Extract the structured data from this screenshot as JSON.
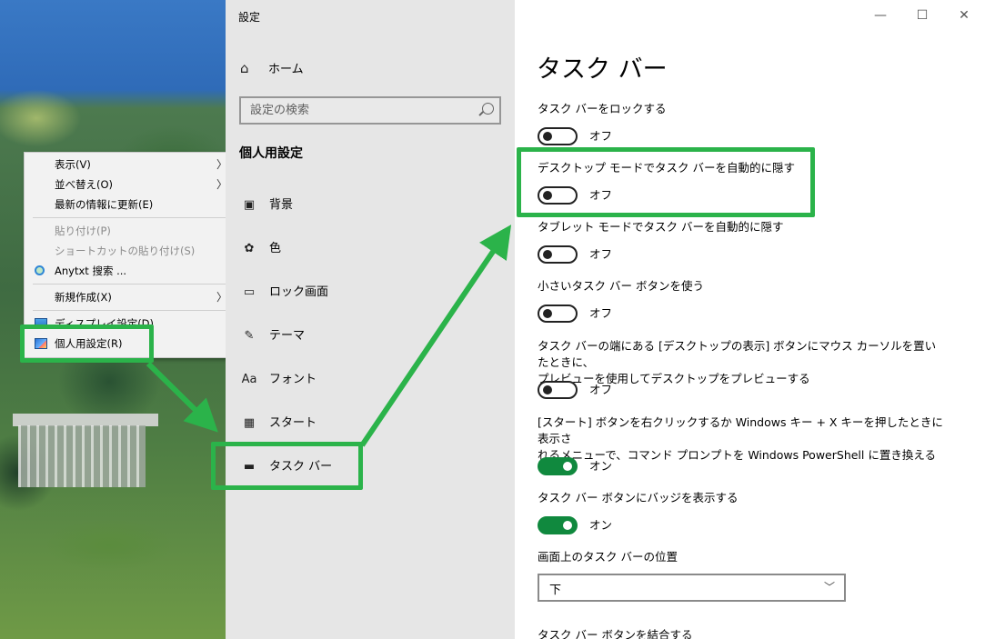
{
  "window": {
    "title": "設定",
    "min_glyph": "—",
    "max_glyph": "☐",
    "close_glyph": "✕"
  },
  "context_menu": {
    "items": [
      {
        "label": "表示(V)",
        "submenu": true,
        "disabled": false
      },
      {
        "label": "並べ替え(O)",
        "submenu": true,
        "disabled": false
      },
      {
        "label": "最新の情報に更新(E)",
        "submenu": false,
        "disabled": false
      },
      {
        "label": "貼り付け(P)",
        "submenu": false,
        "disabled": true
      },
      {
        "label": "ショートカットの貼り付け(S)",
        "submenu": false,
        "disabled": true
      },
      {
        "label": "Anytxt 搜索 ...",
        "submenu": false,
        "disabled": false,
        "icon": "search-icon"
      },
      {
        "label": "新規作成(X)",
        "submenu": true,
        "disabled": false
      },
      {
        "label": "ディスプレイ設定(D)",
        "submenu": false,
        "disabled": false,
        "icon": "display-icon"
      },
      {
        "label": "個人用設定(R)",
        "submenu": false,
        "disabled": false,
        "icon": "personalize-icon"
      }
    ],
    "submenu_glyph": "〉"
  },
  "nav": {
    "home": "ホーム",
    "search_placeholder": "設定の検索",
    "section": "個人用設定",
    "items": [
      {
        "label": "背景",
        "icon": "picture-icon"
      },
      {
        "label": "色",
        "icon": "palette-icon"
      },
      {
        "label": "ロック画面",
        "icon": "lock-screen-icon"
      },
      {
        "label": "テーマ",
        "icon": "theme-icon"
      },
      {
        "label": "フォント",
        "icon": "font-icon"
      },
      {
        "label": "スタート",
        "icon": "start-icon"
      },
      {
        "label": "タスク バー",
        "icon": "taskbar-icon",
        "selected": true
      }
    ]
  },
  "content": {
    "heading": "タスク バー",
    "settings": [
      {
        "label": "タスク バーをロックする",
        "state": "オフ",
        "on": false
      },
      {
        "label": "デスクトップ モードでタスク バーを自動的に隠す",
        "state": "オフ",
        "on": false
      },
      {
        "label": "タブレット モードでタスク バーを自動的に隠す",
        "state": "オフ",
        "on": false
      },
      {
        "label": "小さいタスク バー ボタンを使う",
        "state": "オフ",
        "on": false
      },
      {
        "label_line1": "タスク バーの端にある [デスクトップの表示] ボタンにマウス カーソルを置いたときに、",
        "label_line2": "プレビューを使用してデスクトップをプレビューする",
        "state": "オフ",
        "on": false
      },
      {
        "label_line1": "[スタート] ボタンを右クリックするか Windows キー + X キーを押したときに表示さ",
        "label_line2": "れるメニューで、コマンド プロンプトを Windows PowerShell に置き換える",
        "state": "オン",
        "on": true
      },
      {
        "label": "タスク バー ボタンにバッジを表示する",
        "state": "オン",
        "on": true
      }
    ],
    "position_label": "画面上のタスク バーの位置",
    "position_value": "下",
    "combine_label": "タスク バー ボタンを結合する"
  },
  "colors": {
    "annotation": "#2bb34a",
    "toggle_on": "#10893e",
    "nav_bg": "#e6e6e6"
  }
}
